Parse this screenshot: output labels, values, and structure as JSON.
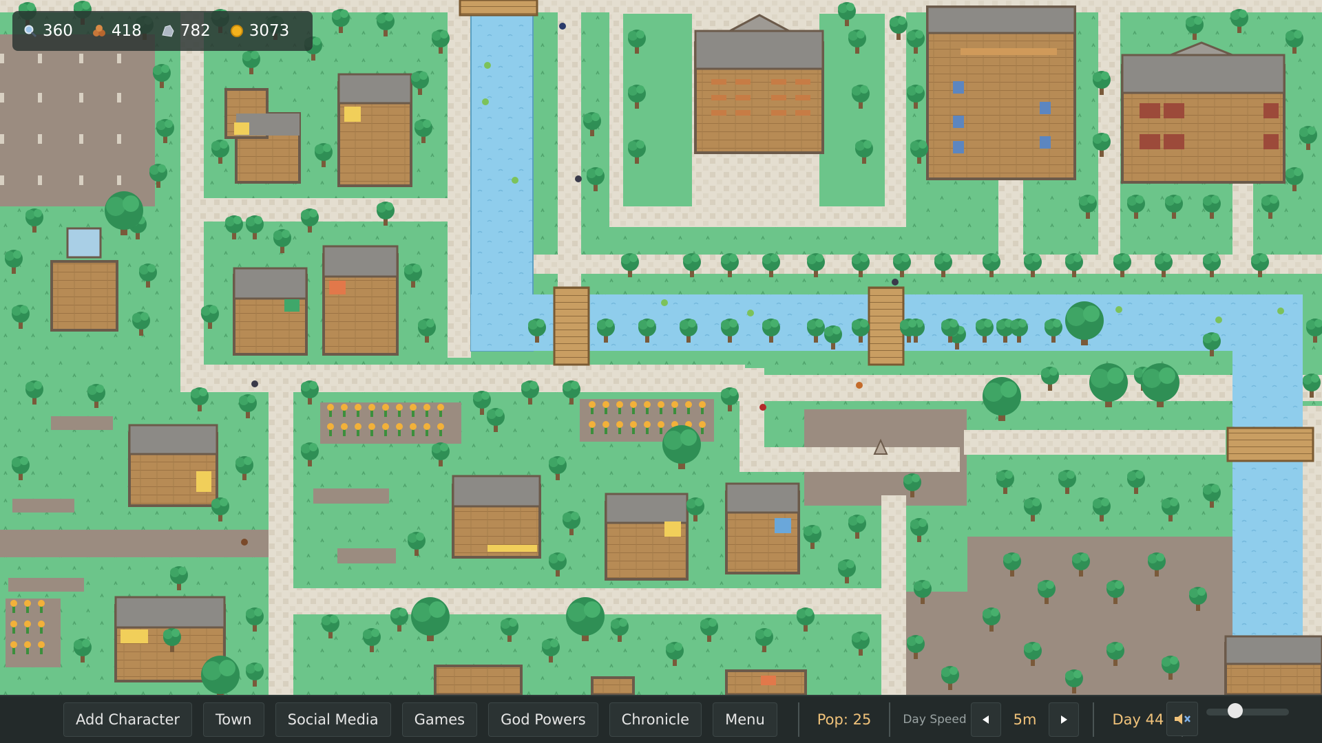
{
  "resources": [
    {
      "icon": "magnifier-icon",
      "value": "360"
    },
    {
      "icon": "wood-icon",
      "value": "418"
    },
    {
      "icon": "stone-icon",
      "value": "782"
    },
    {
      "icon": "gold-coin-icon",
      "value": "3073"
    }
  ],
  "toolbar": {
    "add_character": "Add Character",
    "town": "Town",
    "social_media": "Social Media",
    "games": "Games",
    "god_powers": "God Powers",
    "chronicle": "Chronicle",
    "menu": "Menu",
    "population": "Pop: 25",
    "day_speed_label": "Day Speed",
    "day_speed_value": "5m",
    "day": "Day 44",
    "volume": 0.35
  },
  "colors": {
    "grass": "#6cc58a",
    "path": "#e4ded0",
    "water": "#8fcdec",
    "dirt": "#9b8c80",
    "wood_floor": "#b78b55",
    "accent_gold": "#f0c27a",
    "bar_bg": "#232a2a"
  }
}
